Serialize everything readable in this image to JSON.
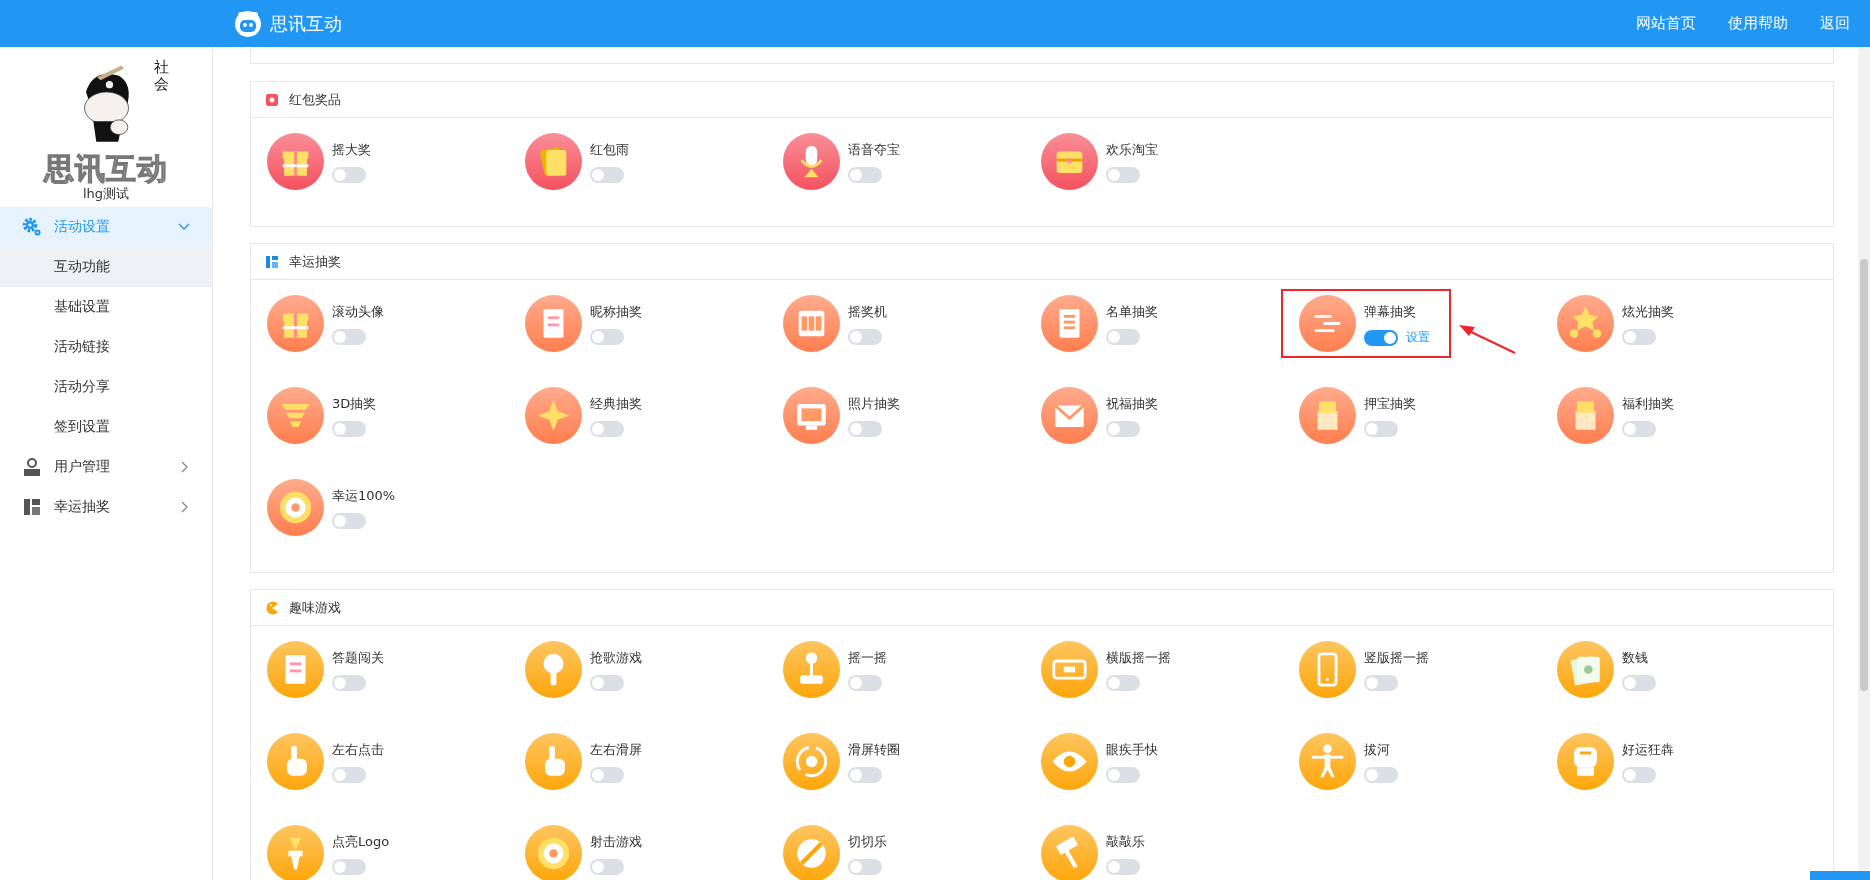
{
  "header": {
    "title": "思讯互动",
    "links": [
      "网站首页",
      "使用帮助",
      "返回"
    ]
  },
  "sidebar": {
    "logo": {
      "caption": "思讯互动",
      "tag": "社会"
    },
    "username": "lhg测试",
    "menu": [
      {
        "label": "活动设置",
        "expanded": true,
        "selected": true,
        "children": [
          {
            "label": "互动功能",
            "selected": true
          },
          {
            "label": "基础设置",
            "selected": false
          },
          {
            "label": "活动链接",
            "selected": false
          },
          {
            "label": "活动分享",
            "selected": false
          },
          {
            "label": "签到设置",
            "selected": false
          }
        ]
      },
      {
        "label": "用户管理",
        "expanded": false,
        "selected": false
      },
      {
        "label": "幸运抽奖",
        "expanded": false,
        "selected": false
      }
    ]
  },
  "sections": [
    {
      "title": "红包奖品",
      "color": "#f5515f",
      "items": [
        {
          "label": "摇大奖",
          "on": false
        },
        {
          "label": "红包雨",
          "on": false
        },
        {
          "label": "语音夺宝",
          "on": false
        },
        {
          "label": "欢乐淘宝",
          "on": false
        }
      ]
    },
    {
      "title": "幸运抽奖",
      "color": "#ff7e4f",
      "items": [
        {
          "label": "滚动头像",
          "on": false
        },
        {
          "label": "昵称抽奖",
          "on": false
        },
        {
          "label": "摇奖机",
          "on": false
        },
        {
          "label": "名单抽奖",
          "on": false
        },
        {
          "label": "弹幕抽奖",
          "on": true,
          "setting_link": "设置",
          "highlighted": true
        },
        {
          "label": "炫光抽奖",
          "on": false
        },
        {
          "label": "3D抽奖",
          "on": false
        },
        {
          "label": "经典抽奖",
          "on": false
        },
        {
          "label": "照片抽奖",
          "on": false
        },
        {
          "label": "祝福抽奖",
          "on": false
        },
        {
          "label": "押宝抽奖",
          "on": false
        },
        {
          "label": "福利抽奖",
          "on": false
        },
        {
          "label": "幸运100%",
          "on": false
        }
      ]
    },
    {
      "title": "趣味游戏",
      "color": "#fda60a",
      "items": [
        {
          "label": "答题闯关",
          "on": false
        },
        {
          "label": "抢歌游戏",
          "on": false
        },
        {
          "label": "摇一摇",
          "on": false
        },
        {
          "label": "横版摇一摇",
          "on": false
        },
        {
          "label": "竖版摇一摇",
          "on": false
        },
        {
          "label": "数钱",
          "on": false
        },
        {
          "label": "左右点击",
          "on": false
        },
        {
          "label": "左右滑屏",
          "on": false
        },
        {
          "label": "滑屏转圈",
          "on": false
        },
        {
          "label": "眼疾手快",
          "on": false
        },
        {
          "label": "拔河",
          "on": false
        },
        {
          "label": "好运狂犇",
          "on": false
        },
        {
          "label": "点亮Logo",
          "on": false
        },
        {
          "label": "射击游戏",
          "on": false
        },
        {
          "label": "切切乐",
          "on": false
        },
        {
          "label": "敲敲乐",
          "on": false
        }
      ]
    }
  ]
}
